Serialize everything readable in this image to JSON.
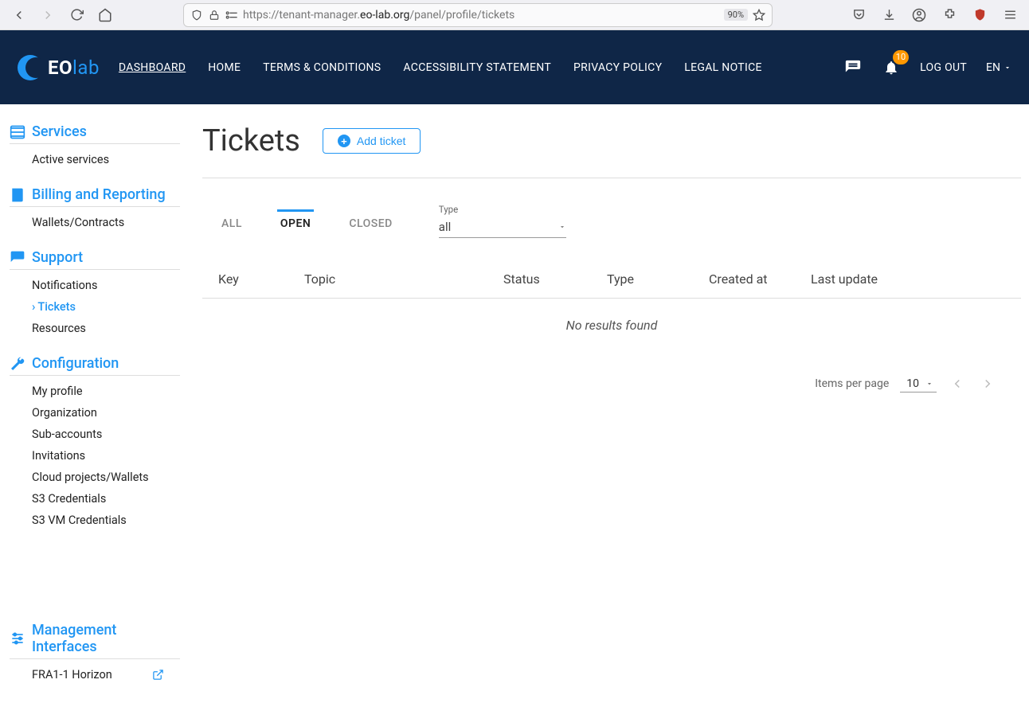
{
  "browser": {
    "url_prefix": "https://tenant-manager.",
    "url_host": "eo-lab.org",
    "url_path": "/panel/profile/tickets",
    "zoom": "90%"
  },
  "logo": {
    "part1": "EO",
    "part2": "lab"
  },
  "nav": {
    "dashboard": "DASHBOARD",
    "home": "HOME",
    "terms": "TERMS & CONDITIONS",
    "accessibility": "ACCESSIBILITY STATEMENT",
    "privacy": "PRIVACY POLICY",
    "legal": "LEGAL NOTICE",
    "notification_count": "10",
    "logout": "LOG OUT",
    "lang": "EN"
  },
  "sidebar": {
    "services": {
      "title": "Services",
      "items": [
        "Active services"
      ]
    },
    "billing": {
      "title": "Billing and Reporting",
      "items": [
        "Wallets/Contracts"
      ]
    },
    "support": {
      "title": "Support",
      "items": [
        "Notifications",
        "Tickets",
        "Resources"
      ],
      "active_index": 1
    },
    "configuration": {
      "title": "Configuration",
      "items": [
        "My profile",
        "Organization",
        "Sub-accounts",
        "Invitations",
        "Cloud projects/Wallets",
        "S3 Credentials",
        "S3 VM Credentials"
      ]
    },
    "management": {
      "title": "Management Interfaces",
      "items": [
        "FRA1-1 Horizon"
      ]
    }
  },
  "page": {
    "title": "Tickets",
    "add_label": "Add ticket"
  },
  "tabs": {
    "all": "ALL",
    "open": "OPEN",
    "closed": "CLOSED"
  },
  "filter": {
    "type_label": "Type",
    "type_value": "all"
  },
  "table": {
    "columns": {
      "key": "Key",
      "topic": "Topic",
      "status": "Status",
      "type": "Type",
      "created": "Created at",
      "updated": "Last update"
    },
    "no_results": "No results found"
  },
  "pagination": {
    "label": "Items per page",
    "value": "10"
  }
}
